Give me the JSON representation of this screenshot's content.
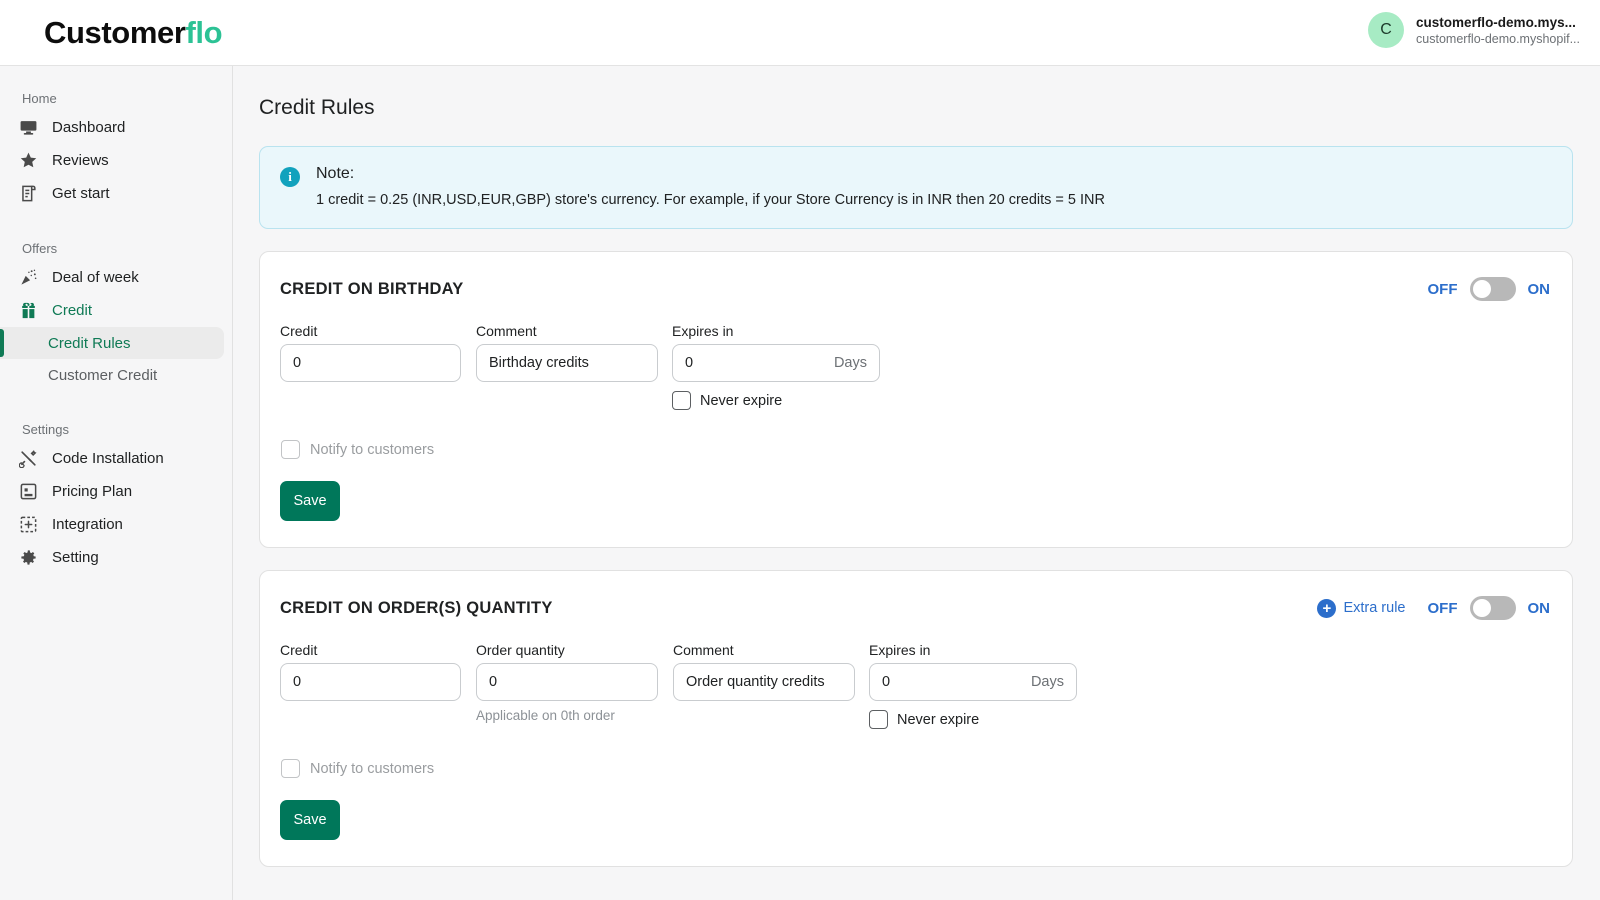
{
  "brand": {
    "name_dark": "Customer",
    "name_accent": "flo",
    "accent_color": "#2cc295"
  },
  "account": {
    "avatar_initial": "C",
    "name": "customerflo-demo.mys...",
    "shop": "customerflo-demo.myshopif..."
  },
  "sidebar": {
    "groups": [
      {
        "label": "Home",
        "items": [
          {
            "label": "Dashboard",
            "icon": "monitor-icon"
          },
          {
            "label": "Reviews",
            "icon": "star-icon"
          },
          {
            "label": "Get start",
            "icon": "scroll-icon"
          }
        ]
      },
      {
        "label": "Offers",
        "items": [
          {
            "label": "Deal of week",
            "icon": "party-popper-icon"
          },
          {
            "label": "Credit",
            "icon": "gift-icon"
          }
        ],
        "subitems": [
          {
            "label": "Credit Rules",
            "active": true
          },
          {
            "label": "Customer Credit",
            "active": false
          }
        ]
      },
      {
        "label": "Settings",
        "items": [
          {
            "label": "Code Installation",
            "icon": "tools-icon"
          },
          {
            "label": "Pricing Plan",
            "icon": "pricing-icon"
          },
          {
            "label": "Integration",
            "icon": "integration-icon"
          },
          {
            "label": "Setting",
            "icon": "gear-icon"
          }
        ]
      }
    ]
  },
  "page": {
    "title": "Credit Rules"
  },
  "note": {
    "icon": "info-icon",
    "title": "Note:",
    "text": "1 credit = 0.25 (INR,USD,EUR,GBP) store's currency. For example, if your Store Currency is in INR then 20 credits = 5 INR"
  },
  "birthday": {
    "title": "CREDIT ON BIRTHDAY",
    "toggle": {
      "off_label": "OFF",
      "on_label": "ON",
      "state": "off"
    },
    "credit": {
      "label": "Credit",
      "value": "0"
    },
    "comment": {
      "label": "Comment",
      "value": "Birthday credits"
    },
    "expires": {
      "label": "Expires in",
      "value": "0",
      "suffix": "Days"
    },
    "never_expire": {
      "label": "Never expire",
      "checked": false
    },
    "notify": {
      "label": "Notify to customers",
      "checked": false,
      "disabled": true
    },
    "save_label": "Save"
  },
  "order_quantity": {
    "title": "CREDIT ON ORDER(S) QUANTITY",
    "extra_rule_label": "Extra rule",
    "toggle": {
      "off_label": "OFF",
      "on_label": "ON",
      "state": "off"
    },
    "credit": {
      "label": "Credit",
      "value": "0"
    },
    "order_quantity": {
      "label": "Order quantity",
      "value": "0",
      "helper": "Applicable on 0th order"
    },
    "comment": {
      "label": "Comment",
      "value": "Order quantity credits"
    },
    "expires": {
      "label": "Expires in",
      "value": "0",
      "suffix": "Days"
    },
    "never_expire": {
      "label": "Never expire",
      "checked": false
    },
    "notify": {
      "label": "Notify to customers",
      "checked": false,
      "disabled": true
    },
    "save_label": "Save"
  },
  "colors": {
    "brand_green": "#0f7a55",
    "save_green": "#00775a",
    "link_blue": "#2c6ecb",
    "info_teal": "#12a2bd",
    "note_bg": "#eaf7fb"
  }
}
